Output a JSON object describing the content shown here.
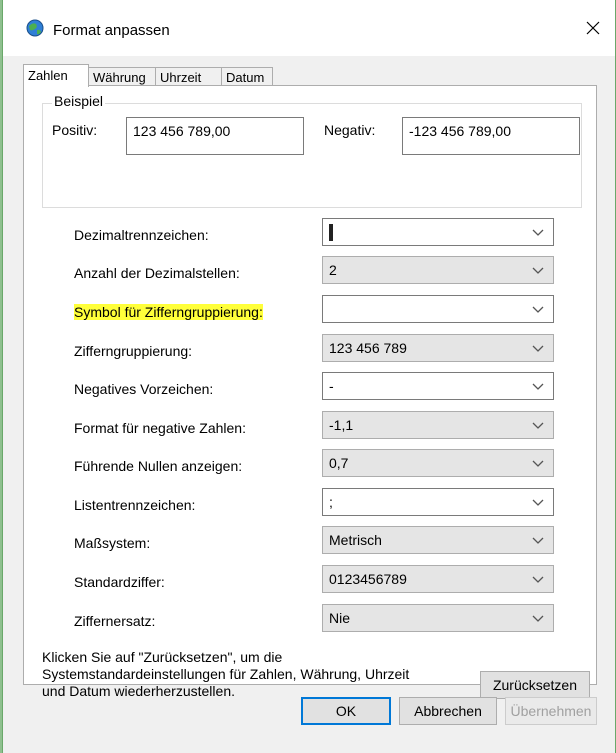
{
  "window": {
    "title": "Format anpassen"
  },
  "tabs": [
    "Zahlen",
    "Währung",
    "Uhrzeit",
    "Datum"
  ],
  "example": {
    "group_label": "Beispiel",
    "positive_label": "Positiv:",
    "positive_value": "123 456 789,00",
    "negative_label": "Negativ:",
    "negative_value": "-123 456 789,00"
  },
  "settings": [
    {
      "label": "Dezimaltrennzeichen:",
      "value": ""
    },
    {
      "label": "Anzahl der Dezimalstellen:",
      "value": "2"
    },
    {
      "label": "Symbol für Zifferngruppierung:",
      "value": ""
    },
    {
      "label": "Zifferngruppierung:",
      "value": "123 456 789"
    },
    {
      "label": "Negatives Vorzeichen:",
      "value": "-"
    },
    {
      "label": "Format für negative Zahlen:",
      "value": "-1,1"
    },
    {
      "label": "Führende Nullen anzeigen:",
      "value": "0,7"
    },
    {
      "label": "Listentrennzeichen:",
      "value": ";"
    },
    {
      "label": "Maßsystem:",
      "value": "Metrisch"
    },
    {
      "label": "Standardziffer:",
      "value": "0123456789"
    },
    {
      "label": "Ziffernersatz:",
      "value": "Nie"
    }
  ],
  "info": {
    "line1": "Klicken Sie auf \"Zurücksetzen\", um die",
    "line2": "Systemstandardeinstellungen für Zahlen, Währung, Uhrzeit",
    "line3": "und Datum wiederherzustellen."
  },
  "buttons": {
    "reset": "Zurücksetzen",
    "ok": "OK",
    "cancel": "Abbrechen",
    "apply": "Übernehmen"
  },
  "colors": {
    "highlight": "#ffff3a",
    "accent": "#0078d7"
  }
}
